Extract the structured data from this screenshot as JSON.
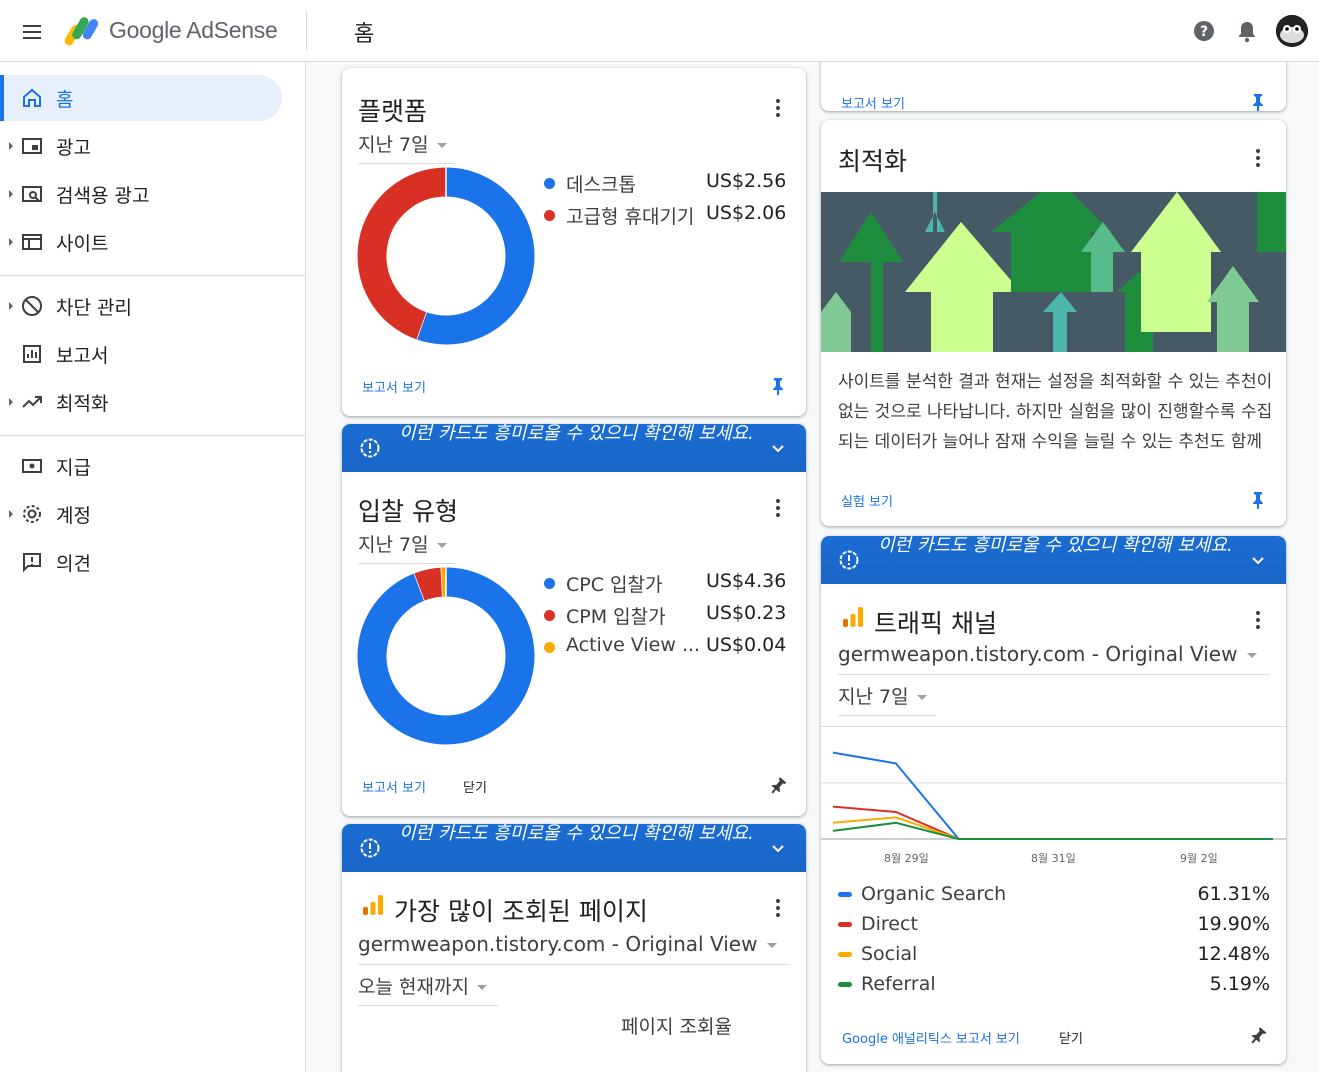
{
  "app": {
    "logo_text": "Google AdSense",
    "page_title": "홈"
  },
  "sidebar": {
    "items": [
      {
        "label": "홈"
      },
      {
        "label": "광고"
      },
      {
        "label": "검색용 광고"
      },
      {
        "label": "사이트"
      },
      {
        "label": "차단 관리"
      },
      {
        "label": "보고서"
      },
      {
        "label": "최적화"
      },
      {
        "label": "지급"
      },
      {
        "label": "계정"
      },
      {
        "label": "의견"
      }
    ]
  },
  "platform_card": {
    "title": "플랫폼",
    "range": "지난 7일",
    "legend": [
      {
        "label": "데스크톱",
        "value": "US$2.56",
        "color": "#1a73e8"
      },
      {
        "label": "고급형 휴대기기",
        "value": "US$2.06",
        "color": "#d93025"
      }
    ],
    "report_link": "보고서 보기"
  },
  "suggest_banner": {
    "text": "이런 카드도 흥미로울 수 있으니 확인해 보세요."
  },
  "bid_card": {
    "title": "입찰 유형",
    "range": "지난 7일",
    "legend": [
      {
        "label": "CPC 입찰가",
        "value": "US$4.36",
        "color": "#1a73e8"
      },
      {
        "label": "CPM 입찰가",
        "value": "US$0.23",
        "color": "#d93025"
      },
      {
        "label": "Active View ...",
        "value": "US$0.04",
        "color": "#f9ab00"
      }
    ],
    "report_link": "보고서 보기",
    "close": "닫기"
  },
  "pages_card": {
    "title": "가장 많이 조회된 페이지",
    "site": "germweapon.tistory.com - Original View",
    "range": "오늘 현재까지",
    "column_header": "페이지 조회율"
  },
  "report_card_top": {
    "report_link": "보고서 보기"
  },
  "optimize_card": {
    "title": "최적화",
    "text": "사이트를 분석한 결과 현재는 설정을 최적화할 수 있는 추천이 없는 것으로 나타납니다. 하지만 실험을 많이 진행할수록 수집되는 데이터가 늘어나 잠재 수익을 늘릴 수 있는 추천도 함께 늘어날 수 있습니다.",
    "link": "실험 보기"
  },
  "traffic_card": {
    "title": "트래픽 채널",
    "site": "germweapon.tistory.com - Original View",
    "range": "지난 7일",
    "x_ticks": [
      "8월 29일",
      "8월 31일",
      "9월 2일"
    ],
    "legend": [
      {
        "label": "Organic Search",
        "value": "61.31%",
        "color": "#1a73e8"
      },
      {
        "label": "Direct",
        "value": "19.90%",
        "color": "#d93025"
      },
      {
        "label": "Social",
        "value": "12.48%",
        "color": "#f9ab00"
      },
      {
        "label": "Referral",
        "value": "5.19%",
        "color": "#1e8e3e"
      }
    ],
    "report_link": "Google 애널리틱스 보고서 보기",
    "close": "닫기"
  },
  "chart_data": [
    {
      "type": "pie",
      "title": "플랫폼",
      "categories": [
        "데스크톱",
        "고급형 휴대기기"
      ],
      "values": [
        2.56,
        2.06
      ]
    },
    {
      "type": "pie",
      "title": "입찰 유형",
      "categories": [
        "CPC 입찰가",
        "CPM 입찰가",
        "Active View ..."
      ],
      "values": [
        4.36,
        0.23,
        0.04
      ]
    },
    {
      "type": "line",
      "title": "트래픽 채널",
      "x_ticks": [
        "8월 29일",
        "8월 31일",
        "9월 2일"
      ],
      "series": [
        {
          "name": "Organic Search",
          "values": [
            16,
            14,
            0,
            0,
            0,
            0,
            0,
            0
          ]
        },
        {
          "name": "Direct",
          "values": [
            6,
            5,
            0,
            0,
            0,
            0,
            0,
            0
          ]
        },
        {
          "name": "Social",
          "values": [
            3,
            4,
            0,
            0,
            0,
            0,
            0,
            0
          ]
        },
        {
          "name": "Referral",
          "values": [
            1.5,
            3,
            0,
            0,
            0,
            0,
            0,
            0
          ]
        }
      ],
      "ylim": [
        0,
        20
      ]
    }
  ]
}
